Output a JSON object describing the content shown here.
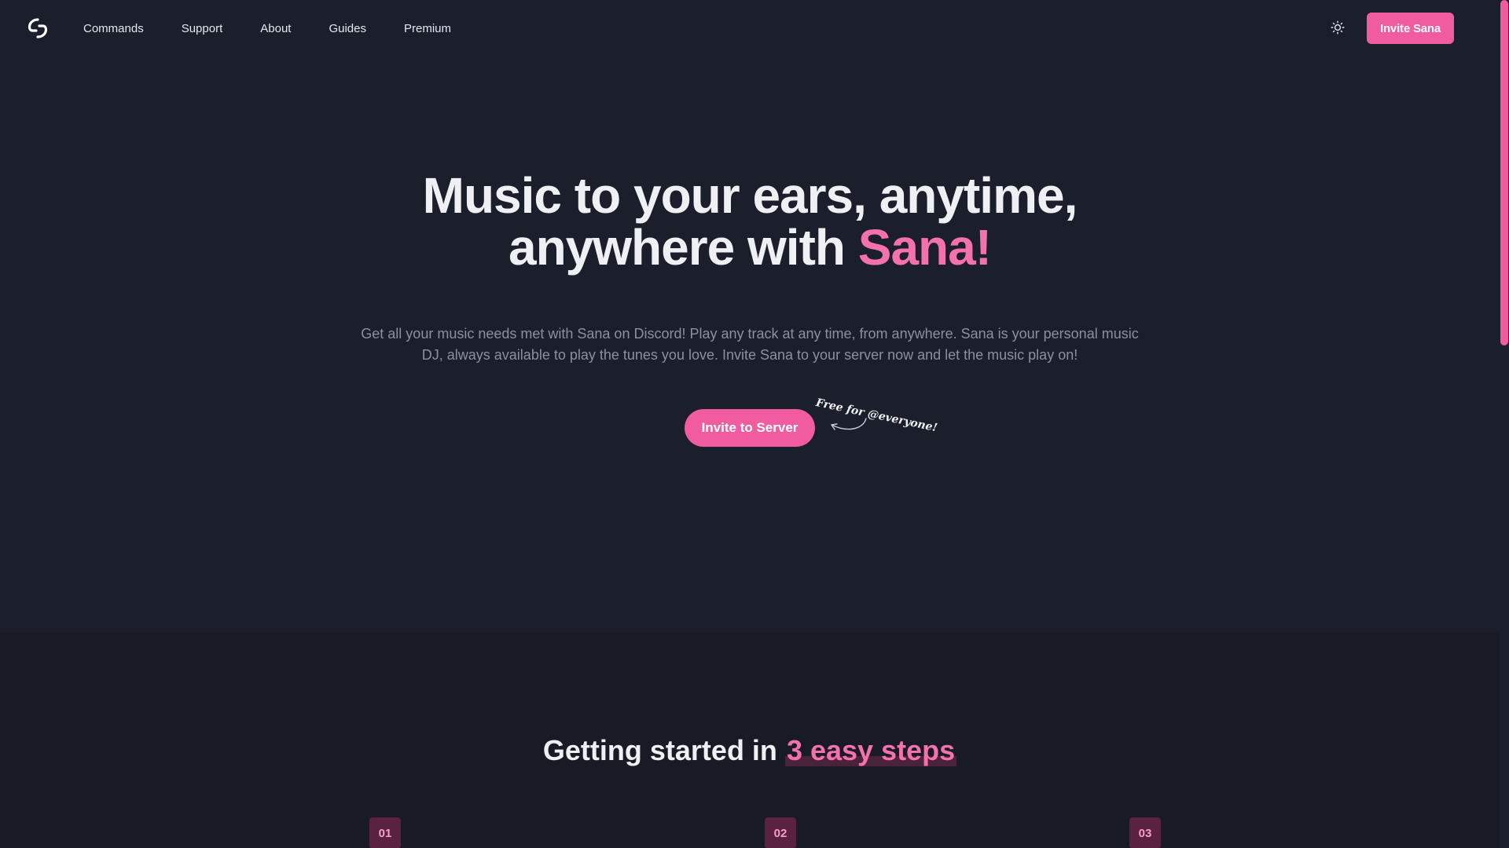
{
  "nav": {
    "links": [
      "Commands",
      "Support",
      "About",
      "Guides",
      "Premium"
    ],
    "invite_label": "Invite Sana"
  },
  "hero": {
    "title_line1": "Music to your ears, anytime,",
    "title_line2_prefix": "anywhere with ",
    "title_accent": "Sana!",
    "description": "Get all your music needs met with Sana on Discord! Play any track at any time, from anywhere. Sana is your personal music DJ, always available to play the tunes you love. Invite Sana to your server now and let the music play on!",
    "cta_label": "Invite to Server",
    "free_note": "Free for @everyone!"
  },
  "steps": {
    "title_prefix": "Getting started in ",
    "title_accent": "3 easy steps",
    "badges": [
      "01",
      "02",
      "03"
    ]
  },
  "colors": {
    "accent": "#f15ba0",
    "background": "#1b1f2b",
    "section_background": "#181b25"
  },
  "icons": {
    "logo": "sana-logo-icon",
    "theme": "sun-icon",
    "arrow": "curved-arrow-icon"
  }
}
